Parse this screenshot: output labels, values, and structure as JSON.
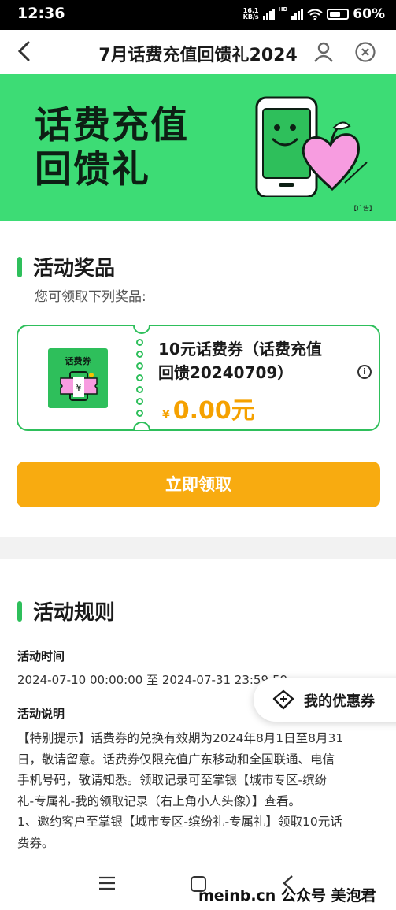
{
  "status_bar": {
    "time": "12:36",
    "net_speed_value": "16.1",
    "net_speed_unit": "KB/s",
    "hd_label": "HD",
    "battery": "60%"
  },
  "header": {
    "title": "7月话费充值回馈礼2024",
    "back_icon": "chevron-left-icon",
    "user_icon": "user-icon",
    "close_icon": "close-circle-icon"
  },
  "banner": {
    "line1": "话费充值",
    "line2": "回馈礼",
    "ad_tag": "【广告】",
    "bg_color": "#3ddc75"
  },
  "prizes": {
    "title": "活动奖品",
    "subtitle": "您可领取下列奖品:",
    "coupon": {
      "thumb_label": "话费券",
      "name_line1": "10元话费券（话费充值",
      "name_line2": "回馈20240709）",
      "currency": "¥",
      "price": "0.00元",
      "info": "i"
    },
    "claim_button": "立即领取"
  },
  "rules": {
    "title": "活动规则",
    "time_label": "活动时间",
    "time_value": "2024-07-10 00:00:00 至 2024-07-31 23:59:59",
    "desc_label": "活动说明",
    "desc_lines": [
      "【特别提示】话费券的兑换有效期为2024年8月1日至8月31",
      "日，敬请留意。话费券仅限充值广东移动和全国联通、电信",
      "手机号码，敬请知悉。领取记录可至掌银【城市专区-缤纷",
      "礼-专属礼-我的领取记录（右上角小人头像）】查看。",
      "1、邀约客户至掌银【城市专区-缤纷礼-专属礼】领取10元话",
      "费券。"
    ]
  },
  "floating": {
    "my_coupons": "我的优惠券"
  },
  "watermark": "meinb.cn  公众号 美泡君",
  "colors": {
    "accent_green": "#2ebf5b",
    "button_orange": "#f8ab10",
    "price_orange": "#f5a100"
  }
}
